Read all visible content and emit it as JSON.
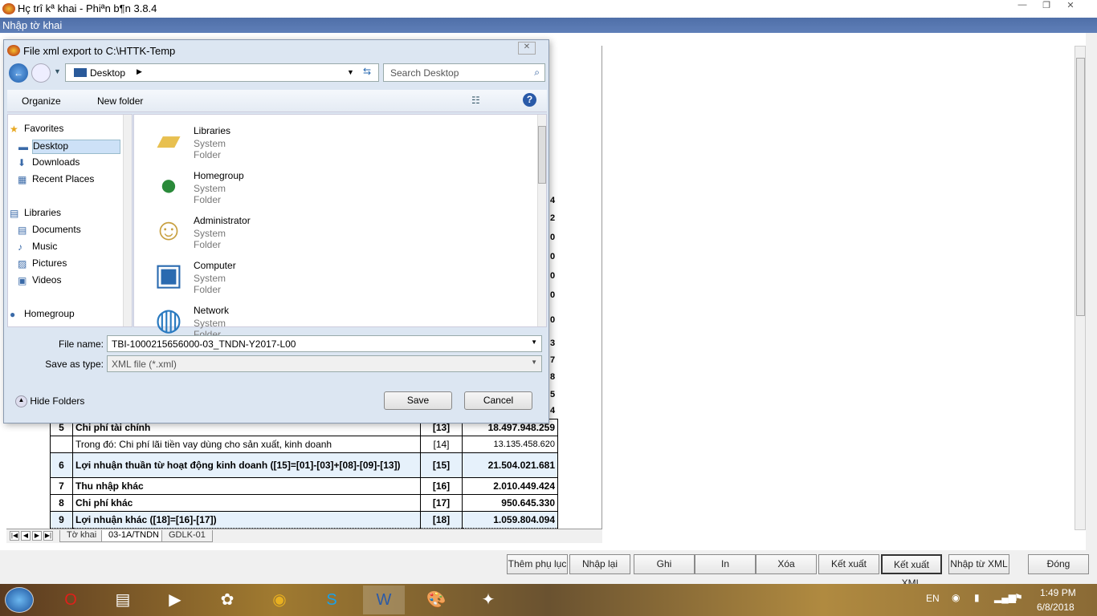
{
  "app": {
    "title": "Hç trî kª khai - Phiªn b¶n 3.8.4",
    "subtitle": "Nhập tờ khai"
  },
  "table": {
    "rows": [
      {
        "num": "5",
        "label": "Chi phí tài chính",
        "code": "[13]",
        "value": "18.497.948.259",
        "bold": true,
        "hl": false
      },
      {
        "num": "",
        "label": "Trong đó: Chi phí lãi tiền vay dùng cho sản xuất, kinh doanh",
        "code": "[14]",
        "value": "13.135.458.620",
        "bold": false,
        "hl": false
      },
      {
        "num": "6",
        "label": "Lợi nhuận thuần từ hoạt động kinh doanh  ([15]=[01]-[03]+[08]-[09]-[13])",
        "code": "[15]",
        "value": "21.504.021.681",
        "bold": true,
        "hl": true
      },
      {
        "num": "7",
        "label": "Thu nhập khác",
        "code": "[16]",
        "value": "2.010.449.424",
        "bold": true,
        "hl": false
      },
      {
        "num": "8",
        "label": "Chi phí khác",
        "code": "[17]",
        "value": "950.645.330",
        "bold": true,
        "hl": false
      },
      {
        "num": "9",
        "label": "Lợi nhuận khác ([18]=[16]-[17])",
        "code": "[18]",
        "value": "1.059.804.094",
        "bold": true,
        "hl": true
      }
    ]
  },
  "peek_digits": [
    "4",
    "2",
    "0",
    "0",
    "0",
    "0",
    "0",
    "3",
    "7",
    "8",
    "5",
    "4"
  ],
  "sheet_tabs": [
    "Tờ khai",
    "03-1A/TNDN",
    "GDLK-01"
  ],
  "active_sheet": "03-1A/TNDN",
  "buttons": [
    "Thêm phụ lục",
    "Nhập lại",
    "Ghi",
    "In",
    "Xóa",
    "Kết xuất",
    "Kết xuất XML",
    "Nhập từ XML",
    "Đóng"
  ],
  "dialog": {
    "title": "File xml export to C:\\HTTK-Temp",
    "address": "Desktop",
    "search_placeholder": "Search Desktop",
    "organize": "Organize",
    "new_folder": "New folder",
    "nav": [
      {
        "label": "Favorites",
        "icon": "star-icon",
        "indent": 0
      },
      {
        "label": "Desktop",
        "icon": "desktop-icon",
        "indent": 1,
        "selected": true
      },
      {
        "label": "Downloads",
        "icon": "downloads-icon",
        "indent": 1
      },
      {
        "label": "Recent Places",
        "icon": "recent-places-icon",
        "indent": 1
      },
      {
        "label": "Libraries",
        "icon": "libraries-icon",
        "indent": 0
      },
      {
        "label": "Documents",
        "icon": "documents-icon",
        "indent": 1
      },
      {
        "label": "Music",
        "icon": "music-icon",
        "indent": 1
      },
      {
        "label": "Pictures",
        "icon": "pictures-icon",
        "indent": 1
      },
      {
        "label": "Videos",
        "icon": "videos-icon",
        "indent": 1
      },
      {
        "label": "Homegroup",
        "icon": "homegroup-icon",
        "indent": 0
      }
    ],
    "items": [
      {
        "name": "Libraries",
        "type": "System Folder",
        "icon": "libraries-folder-icon"
      },
      {
        "name": "Homegroup",
        "type": "System Folder",
        "icon": "homegroup-icon"
      },
      {
        "name": "Administrator",
        "type": "System Folder",
        "icon": "user-folder-icon"
      },
      {
        "name": "Computer",
        "type": "System Folder",
        "icon": "computer-icon"
      },
      {
        "name": "Network",
        "type": "System Folder",
        "icon": "network-icon"
      }
    ],
    "file_name_label": "File name:",
    "file_name": "TBI-1000215656000-03_TNDN-Y2017-L00",
    "save_type_label": "Save as type:",
    "save_type": "XML file (*.xml)",
    "hide_folders": "Hide Folders",
    "save": "Save",
    "cancel": "Cancel"
  },
  "taskbar": {
    "apps": [
      "opera-icon",
      "file-explorer-icon",
      "media-player-icon",
      "app-icon",
      "chrome-icon",
      "skype-icon",
      "word-icon",
      "paint-icon",
      "htkk-icon"
    ],
    "lang": "EN",
    "time": "1:49 PM",
    "date": "6/8/2018"
  }
}
